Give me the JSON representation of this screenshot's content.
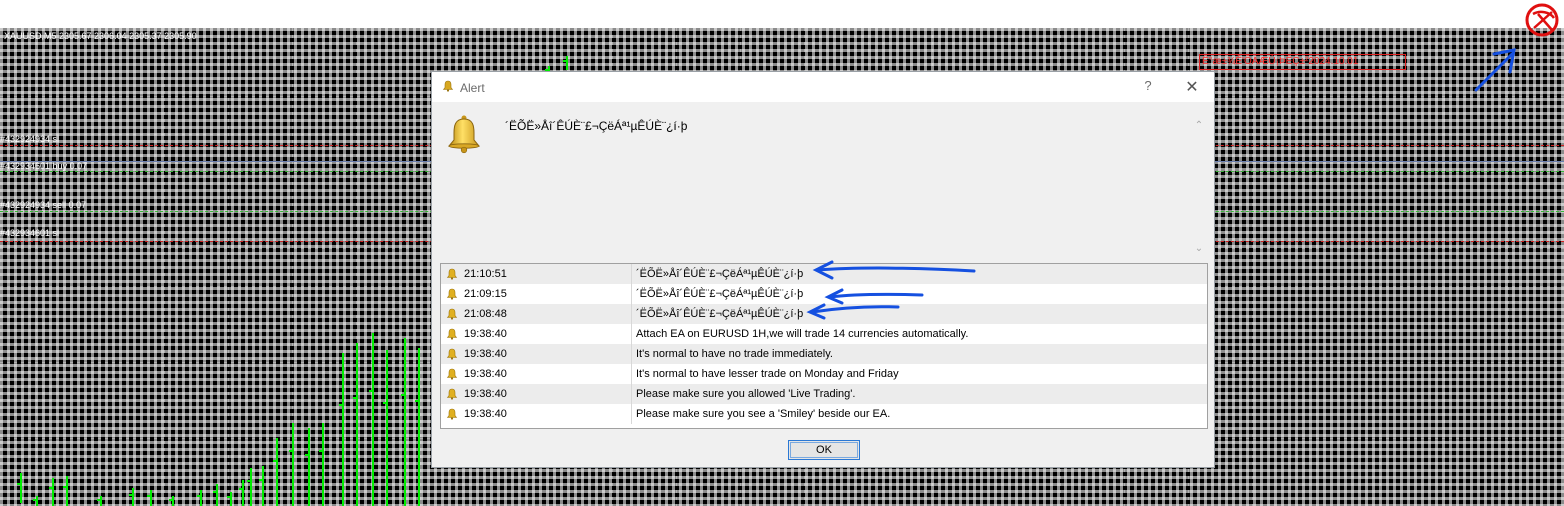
{
  "chart": {
    "symbol_label": "XAUUSD,M5  2305.67 2306.04 2305.37 2305.90",
    "line_labels": [
      {
        "text": "#432924934 sl",
        "kind": "red"
      },
      {
        "text": "#432934601 buy 0.07",
        "kind": "green"
      },
      {
        "text": "#432924934 sell 0.07",
        "kind": "green"
      },
      {
        "text": "#432934601 sl",
        "kind": "red"
      }
    ],
    "red_label": "Ë°æ±¾Ê'ÔÁÆÚ¡ÞÊÇ±²2024.10.01",
    "colors": {
      "background": "#000000",
      "candle": "#00ee00",
      "sl_line": "#d02020",
      "order_line": "#36b836"
    }
  },
  "alert": {
    "title": "Alert",
    "help_label": "?",
    "close_label": "✕",
    "message": "´ËÕË»Åî´ÊÚÈ¨£¬ÇëÁª¹µÊÚÈ¨¿í·þ",
    "scroll_up": "⌃",
    "scroll_down": "⌄",
    "log": [
      {
        "time": "21:10:51",
        "message": "´ËÕË»Åî´ÊÚÈ¨£¬ÇëÁª¹µÊÚÈ¨¿í·þ"
      },
      {
        "time": "21:09:15",
        "message": "´ËÕË»Åî´ÊÚÈ¨£¬ÇëÁª¹µÊÚÈ¨¿í·þ"
      },
      {
        "time": "21:08:48",
        "message": "´ËÕË»Åî´ÊÚÈ¨£¬ÇëÁª¹µÊÚÈ¨¿í·þ"
      },
      {
        "time": "19:38:40",
        "message": "Attach EA on EURUSD 1H,we will trade 14 currencies automatically."
      },
      {
        "time": "19:38:40",
        "message": "It's normal to have no trade immediately."
      },
      {
        "time": "19:38:40",
        "message": "It's normal to have lesser trade on Monday and Friday"
      },
      {
        "time": "19:38:40",
        "message": "Please make sure you allowed 'Live Trading'."
      },
      {
        "time": "19:38:40",
        "message": "Please make sure you see a 'Smiley' beside our EA."
      }
    ],
    "ok_label": "OK"
  }
}
